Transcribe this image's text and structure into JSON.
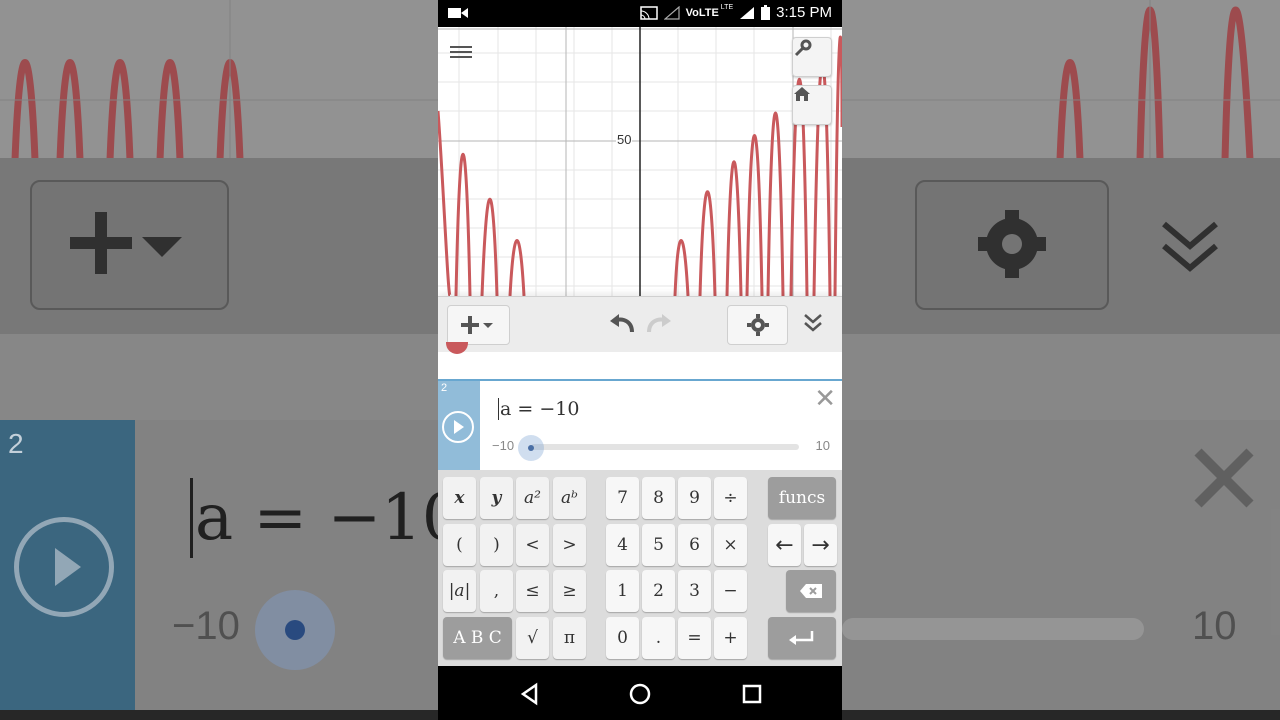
{
  "status_bar": {
    "volte": "VoLTE",
    "lte": "LTE",
    "time": "3:15 PM"
  },
  "graph": {
    "y_axis_label": "50"
  },
  "background": {
    "row_number": "2",
    "expression": "a = −10",
    "slider_min": "−10",
    "slider_max": "10"
  },
  "expression_list": {
    "row2": {
      "number": "2",
      "expression": "a = −10",
      "slider_min": "−10",
      "slider_max": "10",
      "slider_value": -10
    }
  },
  "keypad": {
    "left": [
      [
        "x",
        "y",
        "a²",
        "aᵇ"
      ],
      [
        "(",
        ")",
        "<",
        ">"
      ],
      [
        "|a|",
        ",",
        "≤",
        "≥"
      ],
      [
        "A B C",
        "√",
        "π"
      ]
    ],
    "middle": [
      [
        "7",
        "8",
        "9",
        "÷"
      ],
      [
        "4",
        "5",
        "6",
        "×"
      ],
      [
        "1",
        "2",
        "3",
        "−"
      ],
      [
        "0",
        ".",
        "=",
        "+"
      ]
    ],
    "right": {
      "funcs": "funcs",
      "left_arrow": "←",
      "right_arrow": "→"
    }
  },
  "colors": {
    "graph_curve": "#c9595c",
    "row_tab": "#91bcd9",
    "accent": "#68a7d0"
  }
}
